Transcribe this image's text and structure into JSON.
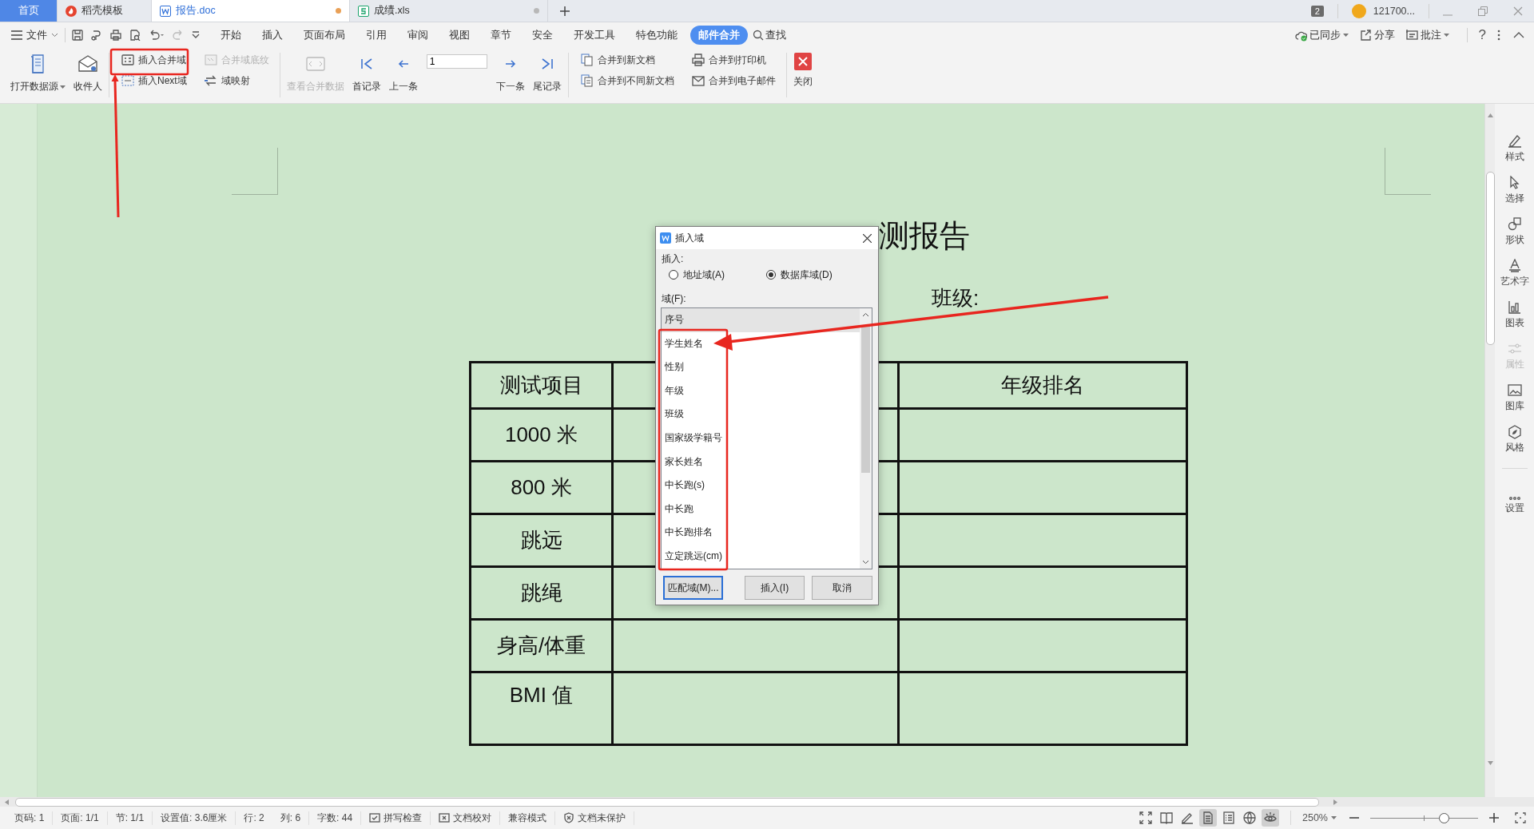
{
  "tabs": [
    {
      "label": "首页",
      "kind": "home",
      "selected": false
    },
    {
      "label": "稻壳模板",
      "kind": "docer",
      "selected": false
    },
    {
      "label": "报告.doc",
      "kind": "writer",
      "selected": true,
      "modified": true
    },
    {
      "label": "成绩.xls",
      "kind": "sheet",
      "selected": false,
      "modified": false
    }
  ],
  "title_bar": {
    "badge": "2",
    "account": "121700..."
  },
  "menu": {
    "file": "文件",
    "items": [
      {
        "label": "开始",
        "selected": false
      },
      {
        "label": "插入",
        "selected": false
      },
      {
        "label": "页面布局",
        "selected": false
      },
      {
        "label": "引用",
        "selected": false
      },
      {
        "label": "审阅",
        "selected": false
      },
      {
        "label": "视图",
        "selected": false
      },
      {
        "label": "章节",
        "selected": false
      },
      {
        "label": "安全",
        "selected": false
      },
      {
        "label": "开发工具",
        "selected": false
      },
      {
        "label": "特色功能",
        "selected": false
      },
      {
        "label": "邮件合并",
        "selected": true
      }
    ],
    "search": "查找",
    "actions": [
      {
        "label": "已同步",
        "dropdown": true
      },
      {
        "label": "分享",
        "dropdown": false
      },
      {
        "label": "批注",
        "dropdown": true
      }
    ],
    "help": "?"
  },
  "ribbon": {
    "groups": [
      {
        "items": [
          {
            "kind": "large",
            "label": "打开数据源",
            "dropdown": true,
            "disabled": false
          },
          {
            "kind": "large",
            "label": "收件人",
            "dropdown": false,
            "disabled": false
          }
        ]
      },
      {
        "items": [
          {
            "kind": "stack",
            "items": [
              {
                "label": "插入合并域",
                "disabled": false
              },
              {
                "label": "插入Next域",
                "disabled": false
              }
            ]
          },
          {
            "kind": "stack",
            "items": [
              {
                "label": "合并域底纹",
                "disabled": true
              },
              {
                "label": "域映射",
                "disabled": false
              }
            ]
          }
        ]
      },
      {
        "items": [
          {
            "kind": "large",
            "label": "查看合并数据",
            "dropdown": false,
            "disabled": true
          },
          {
            "kind": "large",
            "label": "首记录",
            "dropdown": false,
            "disabled": false
          },
          {
            "kind": "large",
            "label": "上一条",
            "dropdown": false,
            "disabled": false
          },
          {
            "kind": "field",
            "value": "1"
          },
          {
            "kind": "large",
            "label": "下一条",
            "dropdown": false,
            "disabled": false
          },
          {
            "kind": "large",
            "label": "尾记录",
            "dropdown": false,
            "disabled": false
          }
        ]
      },
      {
        "items": [
          {
            "kind": "stack",
            "items": [
              {
                "label": "合并到新文档",
                "disabled": false
              },
              {
                "label": "合并到不同新文档",
                "disabled": false
              }
            ]
          },
          {
            "kind": "stack",
            "items": [
              {
                "label": "合并到打印机",
                "disabled": false
              },
              {
                "label": "合并到电子邮件",
                "disabled": false
              }
            ]
          }
        ]
      },
      {
        "items": [
          {
            "kind": "large",
            "label": "关闭",
            "dropdown": false,
            "disabled": false
          }
        ]
      }
    ]
  },
  "document": {
    "title": "测报告",
    "class_label": "班级:",
    "table": {
      "first_header": "测试项目",
      "last_header": "年级排名",
      "rows": [
        "1000 米",
        "800 米",
        "跳远",
        "跳绳",
        "身高/体重",
        "BMI 值"
      ]
    }
  },
  "dialog": {
    "title": "插入域",
    "insert_label": "插入:",
    "options": [
      {
        "label": "地址域(A)",
        "selected": false
      },
      {
        "label": "数据库域(D)",
        "selected": true
      }
    ],
    "fields_label": "域(F):",
    "fields": [
      {
        "label": "序号",
        "selected": true
      },
      {
        "label": "学生姓名",
        "selected": false
      },
      {
        "label": "性别",
        "selected": false
      },
      {
        "label": "年级",
        "selected": false
      },
      {
        "label": "班级",
        "selected": false
      },
      {
        "label": "国家级学籍号",
        "selected": false
      },
      {
        "label": "家长姓名",
        "selected": false
      },
      {
        "label": "中长跑(s)",
        "selected": false
      },
      {
        "label": "中长跑",
        "selected": false
      },
      {
        "label": "中长跑排名",
        "selected": false
      },
      {
        "label": "立定跳远(cm)",
        "selected": false
      }
    ],
    "buttons": [
      "匹配域(M)...",
      "插入(I)",
      "取消"
    ]
  },
  "sidebar": {
    "items": [
      {
        "label": "样式",
        "disabled": false
      },
      {
        "label": "选择",
        "disabled": false
      },
      {
        "label": "形状",
        "disabled": false
      },
      {
        "label": "艺术字",
        "disabled": false
      },
      {
        "label": "图表",
        "disabled": false
      },
      {
        "label": "属性",
        "disabled": true
      },
      {
        "label": "图库",
        "disabled": false
      },
      {
        "label": "风格",
        "disabled": false
      },
      {
        "label": "设置",
        "disabled": false
      }
    ]
  },
  "status_bar": {
    "items": [
      {
        "label": "页码: 1",
        "kind": "text"
      },
      {
        "label": "页面: 1/1",
        "kind": "text"
      },
      {
        "label": "节: 1/1",
        "kind": "text"
      },
      {
        "label": "设置值: 3.6厘米",
        "kind": "text"
      },
      {
        "label": "行: 2",
        "kind": "text"
      },
      {
        "label": "列: 6",
        "kind": "text"
      },
      {
        "label": "字数: 44",
        "kind": "text"
      },
      {
        "label": "拼写检查",
        "kind": "tool"
      },
      {
        "label": "文档校对",
        "kind": "tool"
      },
      {
        "label": "兼容模式",
        "kind": "text"
      },
      {
        "label": "文档未保护",
        "kind": "tool"
      }
    ],
    "views": [
      {
        "selected": false
      },
      {
        "selected": false
      },
      {
        "selected": false
      },
      {
        "selected": true
      },
      {
        "selected": false
      },
      {
        "selected": false
      },
      {
        "selected": true
      }
    ],
    "zoom": "250%",
    "zoom_slider": {
      "level": 0.68
    }
  }
}
